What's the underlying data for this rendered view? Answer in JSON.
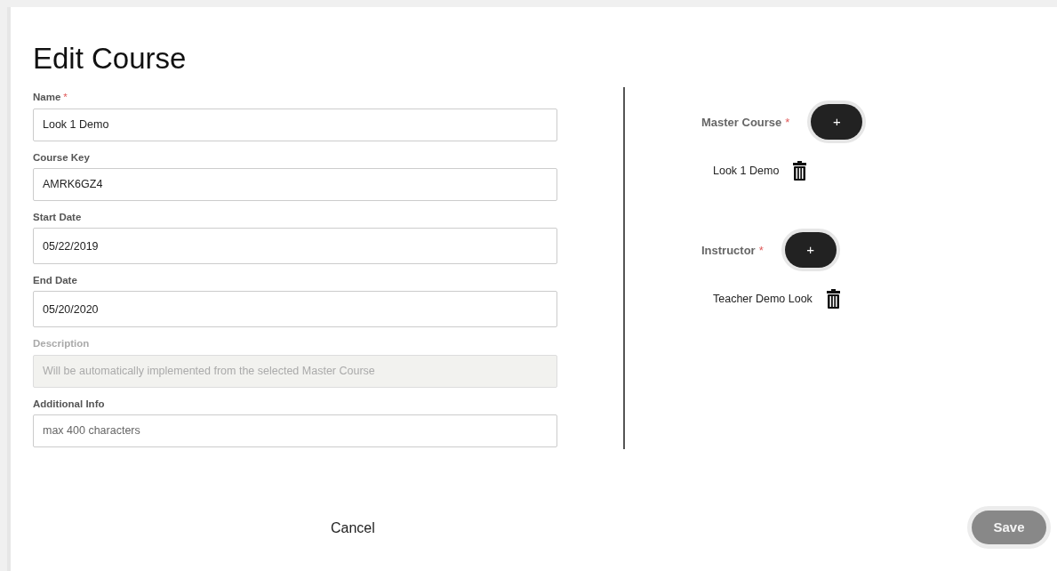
{
  "title": "Edit Course",
  "fields": [
    {
      "label": "Name",
      "marker": "*",
      "value": "Look 1 Demo",
      "disabled": false
    },
    {
      "label": "Course Key",
      "value": "AMRK6GZ4",
      "disabled": false
    },
    {
      "label": "Start Date",
      "value": "05/22/2019",
      "disabled": false,
      "tall": true
    },
    {
      "label": "End Date",
      "value": "05/20/2020",
      "disabled": false,
      "tall": true
    },
    {
      "label": "Description",
      "placeholder": "Will be automatically implemented from the selected Master Course",
      "disabled": true
    },
    {
      "label": "Additional Info",
      "placeholder": "max 400 characters",
      "disabled": false
    }
  ],
  "assignments": [
    {
      "label": "Master Course",
      "marker": "*",
      "add": "+",
      "items": [
        "Look 1 Demo"
      ]
    },
    {
      "label": "Instructor",
      "marker": "*",
      "add": "+",
      "items": [
        "Teacher Demo Look"
      ]
    }
  ],
  "cancel": "Cancel",
  "save": {
    "label": "Save",
    "disabled": true
  }
}
